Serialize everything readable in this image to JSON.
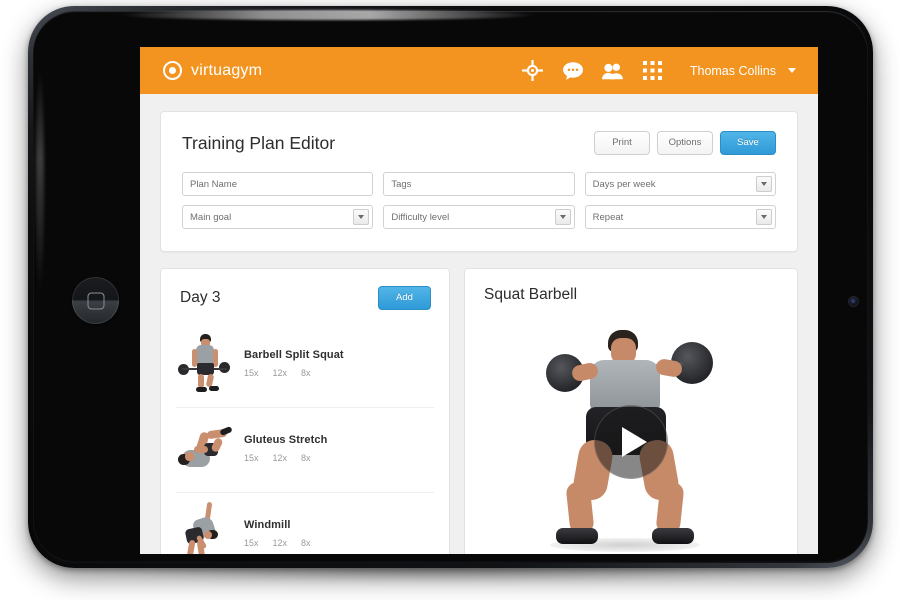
{
  "app": {
    "brand_name": "virtuagym",
    "brand_icon": "target-circle-icon"
  },
  "topnav": {
    "icons": [
      {
        "name": "crosshair-target-icon",
        "label": "Goals"
      },
      {
        "name": "chat-bubble-icon",
        "label": "Messages"
      },
      {
        "name": "people-icon",
        "label": "Contacts"
      },
      {
        "name": "apps-grid-icon",
        "label": "Apps"
      }
    ],
    "user_name": "Thomas Collins",
    "user_caret_icon": "chevron-down-icon",
    "background_color": "#F2941F"
  },
  "editor": {
    "title": "Training Plan Editor",
    "buttons": {
      "print": "Print",
      "options": "Options",
      "save": "Save"
    },
    "accent_blue": "#2F9AD8",
    "fields": [
      {
        "name": "plan-name",
        "placeholder": "Plan Name",
        "type": "text",
        "value": ""
      },
      {
        "name": "tags",
        "placeholder": "Tags",
        "type": "text",
        "value": ""
      },
      {
        "name": "days-per-week",
        "placeholder": "Days per week",
        "type": "select",
        "value": ""
      },
      {
        "name": "main-goal",
        "placeholder": "Main goal",
        "type": "select",
        "value": ""
      },
      {
        "name": "difficulty-level",
        "placeholder": "Difficulty level",
        "type": "select",
        "value": ""
      },
      {
        "name": "repeat",
        "placeholder": "Repeat",
        "type": "select",
        "value": ""
      }
    ]
  },
  "day_panel": {
    "title": "Day 3",
    "add_label": "Add",
    "exercises": [
      {
        "name": "Barbell Split Squat",
        "reps": [
          "15x",
          "12x",
          "8x"
        ],
        "thumb": "barbell-split-squat-thumb"
      },
      {
        "name": "Gluteus Stretch",
        "reps": [
          "15x",
          "12x",
          "8x"
        ],
        "thumb": "gluteus-stretch-thumb"
      },
      {
        "name": "Windmill",
        "reps": [
          "15x",
          "12x",
          "8x"
        ],
        "thumb": "windmill-thumb"
      }
    ]
  },
  "video_panel": {
    "title": "Squat Barbell",
    "play_icon": "play-button-icon"
  },
  "device": {
    "home_button_icon": "home-square-icon",
    "camera_icon": "front-camera-icon"
  }
}
